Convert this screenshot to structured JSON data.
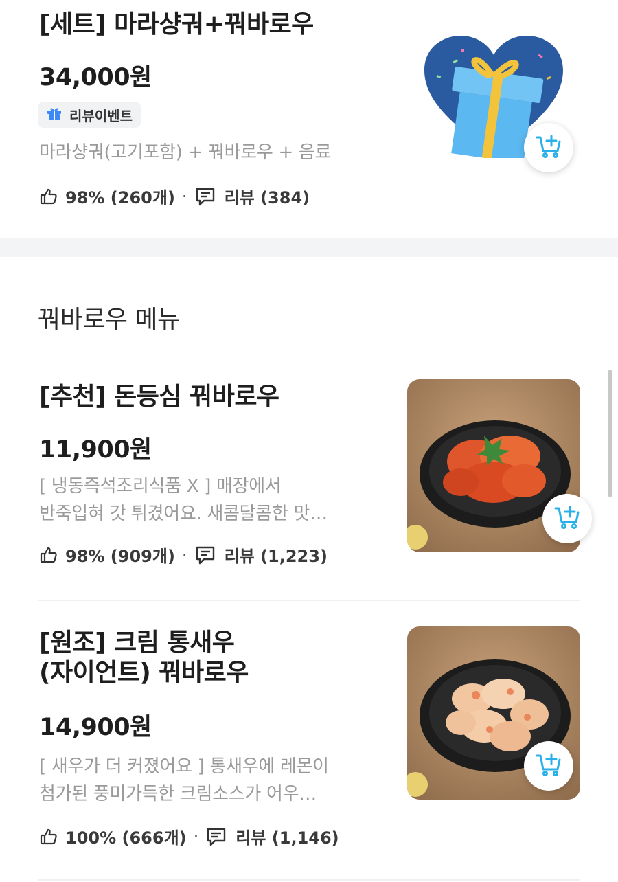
{
  "set_item": {
    "title": "[세트] 마라샹궈+꿔바로우",
    "price": "34,000원",
    "badge": "리뷰이벤트",
    "desc": "마라샹궈(고기포함) + 꿔바로우 + 음료",
    "rating": "98% (260개)",
    "separator": "·",
    "reviews": "리뷰 (384)"
  },
  "section": {
    "title": "꿔바로우 메뉴"
  },
  "items": [
    {
      "title": "[추천] 돈등심 꿔바로우",
      "price": "11,900원",
      "desc_line1": "[ 냉동즉석조리식품 X ] 매장에서",
      "desc_line2": "반죽입혀 갓 튀겼어요. 새콤달콤한 맛…",
      "rating": "98% (909개)",
      "separator": "·",
      "reviews": "리뷰 (1,223)"
    },
    {
      "title_line1": "[원조] 크림 통새우",
      "title_line2": "(자이언트) 꿔바로우",
      "price": "14,900원",
      "desc_line1": "[ 새우가 더 커졌어요 ] 통새우에 레몬이",
      "desc_line2": "첨가된 풍미가득한 크림소스가 어우…",
      "rating": "100% (666개)",
      "separator": "·",
      "reviews": "리뷰 (1,146)"
    }
  ],
  "colors": {
    "accent": "#2ab0e8",
    "heart": "#2a5aa0",
    "gift_box": "#5bb8f0",
    "ribbon": "#f3c43b",
    "band": "#f3f4f6"
  },
  "icons": [
    "gift-icon",
    "thumbs-up-icon",
    "review-icon",
    "cart-add-icon"
  ]
}
